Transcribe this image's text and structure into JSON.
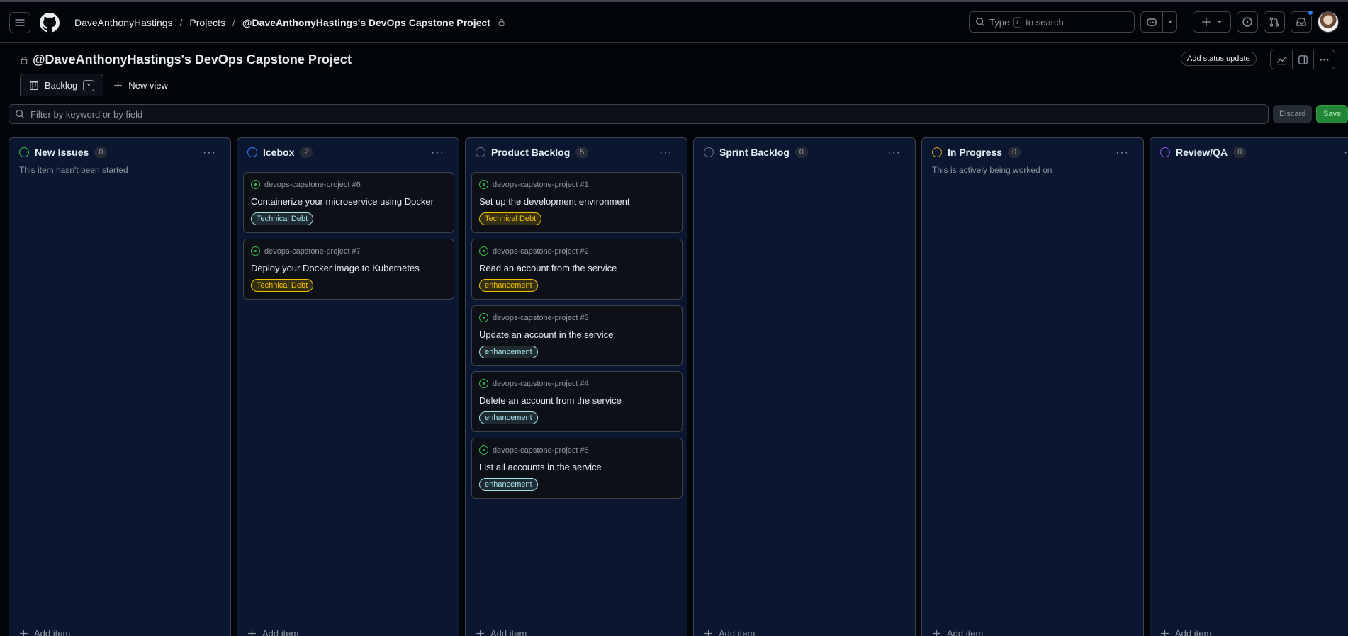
{
  "header": {
    "breadcrumbs": [
      "DaveAnthonyHastings",
      "Projects",
      "@DaveAnthonyHastings's DevOps Capstone Project"
    ],
    "search": {
      "prefix": "Type",
      "key": "/",
      "suffix": "to search"
    }
  },
  "project": {
    "title": "@DaveAnthonyHastings's DevOps Capstone Project",
    "status_update_label": "Add status update",
    "tabs": [
      {
        "label": "Backlog"
      }
    ],
    "new_view_label": "New view"
  },
  "filter": {
    "placeholder": "Filter by keyword or by field",
    "discard_label": "Discard",
    "save_label": "Save"
  },
  "add_item_label": "Add item",
  "columns": [
    {
      "name": "New Issues",
      "count": "0",
      "description": "This item hasn't been started",
      "color": "#3fb950",
      "cards": []
    },
    {
      "name": "Icebox",
      "count": "2",
      "description": "",
      "color": "#2f81f7",
      "cards": [
        {
          "ref": "devops-capstone-project #6",
          "title": "Containerize your microservice using Docker",
          "label": "Technical Debt",
          "label_color": "#a2e4ec"
        },
        {
          "ref": "devops-capstone-project #7",
          "title": "Deploy your Docker image to Kubernetes",
          "label": "Technical Debt",
          "label_color": "#f0c000"
        }
      ]
    },
    {
      "name": "Product Backlog",
      "count": "5",
      "description": "",
      "color": "#6e7681",
      "cards": [
        {
          "ref": "devops-capstone-project #1",
          "title": "Set up the development environment",
          "label": "Technical Debt",
          "label_color": "#f0c000"
        },
        {
          "ref": "devops-capstone-project #2",
          "title": "Read an account from the service",
          "label": "enhancement",
          "label_color": "#f0c000"
        },
        {
          "ref": "devops-capstone-project #3",
          "title": "Update an account in the service",
          "label": "enhancement",
          "label_color": "#a2e4ec"
        },
        {
          "ref": "devops-capstone-project #4",
          "title": "Delete an account from the service",
          "label": "enhancement",
          "label_color": "#a2e4ec"
        },
        {
          "ref": "devops-capstone-project #5",
          "title": "List all accounts in the service",
          "label": "enhancement",
          "label_color": "#a2e4ec"
        }
      ]
    },
    {
      "name": "Sprint Backlog",
      "count": "0",
      "description": "",
      "color": "#6e7681",
      "cards": []
    },
    {
      "name": "In Progress",
      "count": "0",
      "description": "This is actively being worked on",
      "color": "#d29922",
      "cards": []
    },
    {
      "name": "Review/QA",
      "count": "0",
      "description": "",
      "color": "#8957e5",
      "cards": []
    }
  ]
}
